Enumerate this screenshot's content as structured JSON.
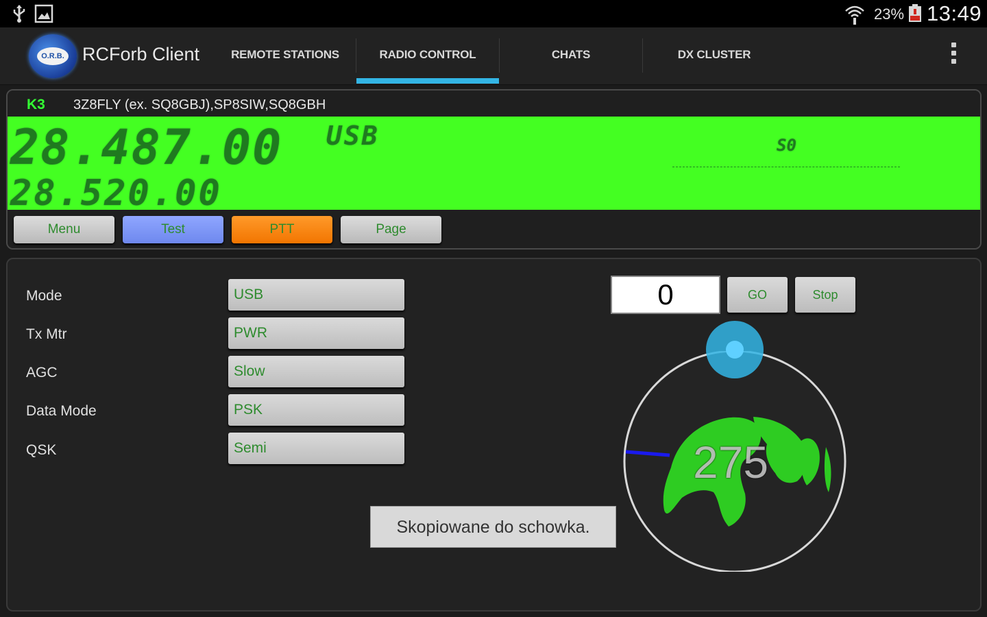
{
  "status_bar": {
    "battery_percent": "23%",
    "time": "13:49",
    "icons": [
      "usb-icon",
      "gallery-icon",
      "wifi-icon",
      "battery-icon"
    ]
  },
  "app": {
    "title": "RCForb Client",
    "logo_text": "O.R.B."
  },
  "tabs": [
    {
      "label": "REMOTE STATIONS",
      "selected": false
    },
    {
      "label": "RADIO CONTROL",
      "selected": true
    },
    {
      "label": "CHATS",
      "selected": false
    },
    {
      "label": "DX CLUSTER",
      "selected": false
    }
  ],
  "radio": {
    "model": "K3",
    "station": "3Z8FLY (ex. SQ8GBJ),SP8SIW,SQ8GBH",
    "vfo_a": "28.487.00",
    "vfo_b": "28.520.00",
    "mode": "USB",
    "s_meter": "S0",
    "buttons": {
      "menu": "Menu",
      "test": "Test",
      "ptt": "PTT",
      "page": "Page"
    }
  },
  "settings": [
    {
      "label": "Mode",
      "value": "USB"
    },
    {
      "label": "Tx Mtr",
      "value": "PWR"
    },
    {
      "label": "AGC",
      "value": "Slow"
    },
    {
      "label": "Data Mode",
      "value": "PSK"
    },
    {
      "label": "QSK",
      "value": "Semi"
    }
  ],
  "rotator": {
    "input_value": "0",
    "go_label": "GO",
    "stop_label": "Stop",
    "bearing": "275"
  },
  "toast": "Skopiowane do schowka.",
  "colors": {
    "accent": "#33b5e5",
    "lcd": "#44ff22",
    "lcd_text": "#1f7a1f",
    "button_text": "#2e8b2e",
    "ptt": "#f27500",
    "test": "#7a92f5"
  }
}
